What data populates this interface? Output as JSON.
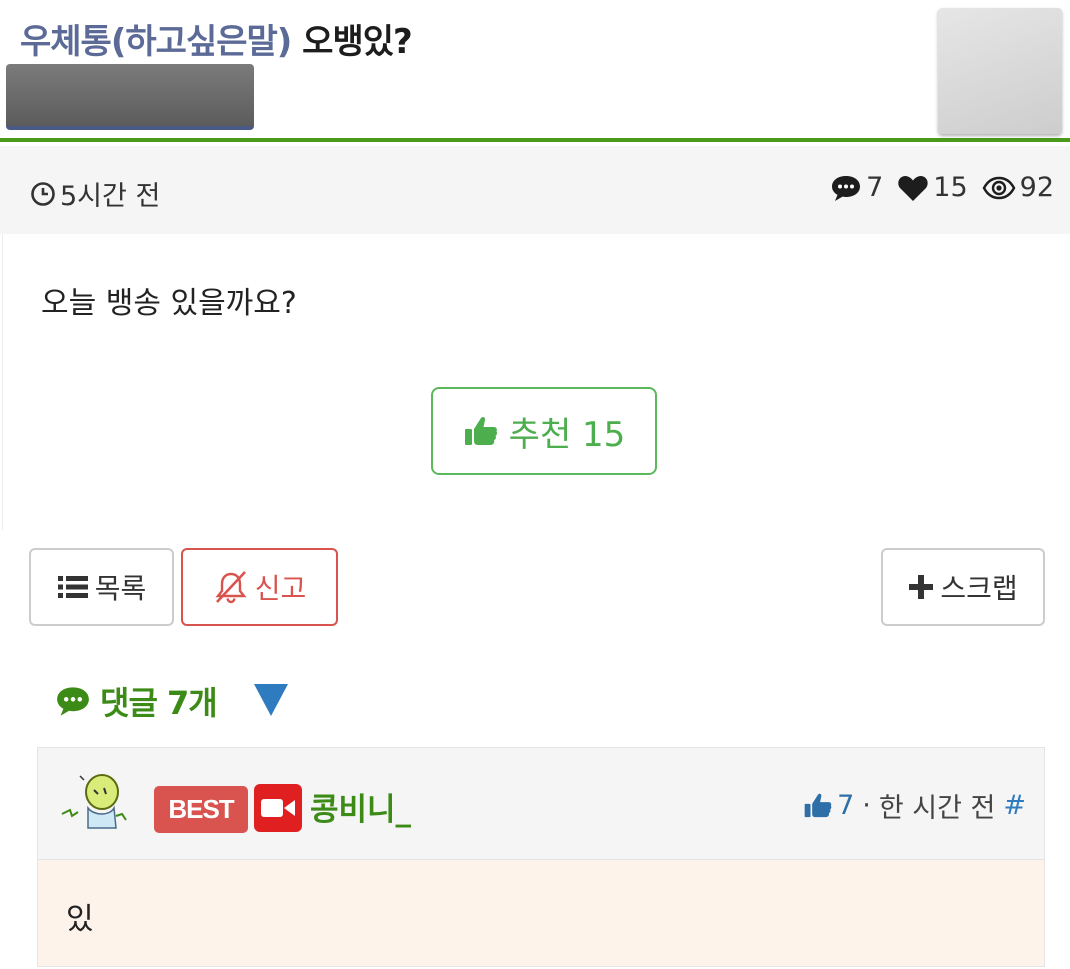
{
  "post": {
    "category": "우체통(하고싶은말)",
    "subject": "오뱅있?",
    "time": "5시간 전",
    "comment_count": "7",
    "like_count": "15",
    "view_count": "92",
    "body": "오늘 뱅송 있을까요?",
    "recommend_label": "추천 15"
  },
  "actions": {
    "list_label": "목록",
    "report_label": "신고",
    "scrap_label": "스크랩"
  },
  "comments": {
    "header": "댓글 7개",
    "items": [
      {
        "badge": "BEST",
        "nickname": "콩비니_",
        "likes": "7",
        "separator": "·",
        "time": "한 시간 전",
        "anchor": "#",
        "text": "있"
      }
    ]
  },
  "colors": {
    "accent_green": "#4a9a1c",
    "category_blue": "#5b6a96",
    "report_red": "#d9534f",
    "link_blue": "#2f7bbf",
    "comment_bg": "#fdf3ea"
  }
}
